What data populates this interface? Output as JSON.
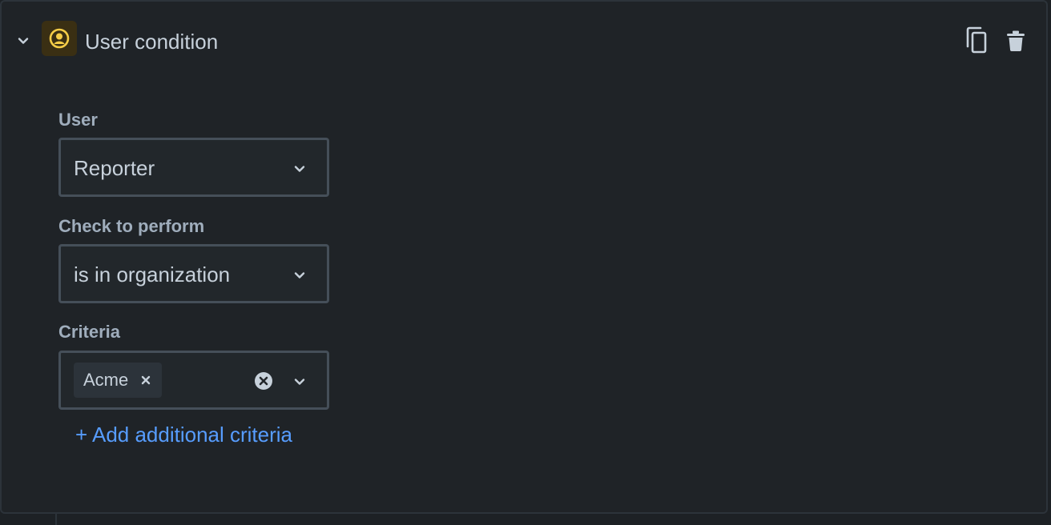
{
  "condition": {
    "title": "User condition",
    "icons": {
      "collapse": "chevron-down-icon",
      "badge": "user-circle-icon",
      "copy": "copy-icon",
      "delete": "trash-icon"
    },
    "colors": {
      "badge_bg": "#3a2f13",
      "badge_icon": "#f5cd47",
      "link": "#579dff"
    }
  },
  "fields": {
    "user": {
      "label": "User",
      "value": "Reporter"
    },
    "check": {
      "label": "Check to perform",
      "value": "is in organization"
    },
    "criteria": {
      "label": "Criteria",
      "tags": [
        "Acme"
      ]
    }
  },
  "actions": {
    "add_criteria": "+ Add additional criteria"
  }
}
